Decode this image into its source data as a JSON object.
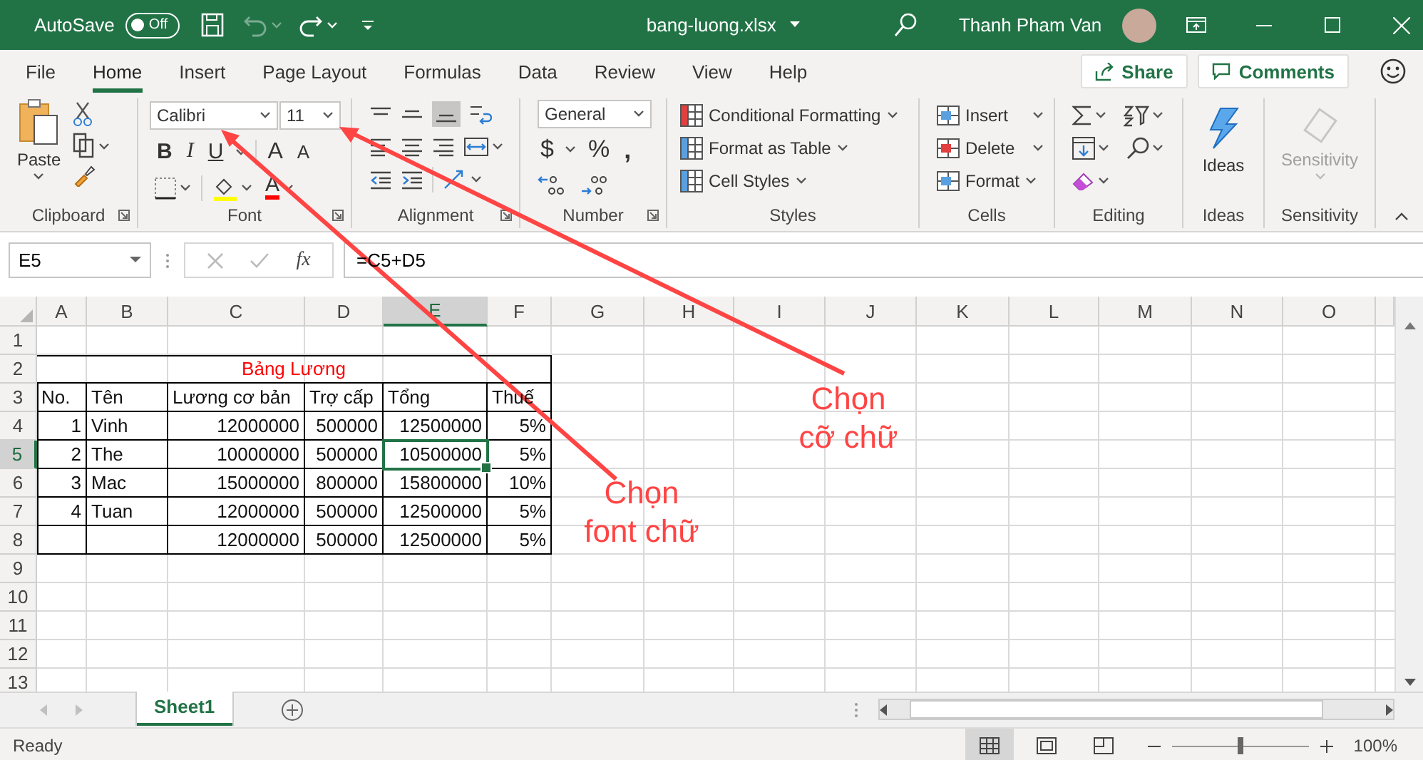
{
  "title_bar": {
    "autosave_label": "AutoSave",
    "autosave_toggle": {
      "label": "Off",
      "on": false
    },
    "undo": {
      "disabled": true
    },
    "filename": "bang-luong.xlsx",
    "user_name": "Thanh Pham Van"
  },
  "menu_tabs": [
    {
      "label": "File",
      "selected": false
    },
    {
      "label": "Home",
      "selected": true
    },
    {
      "label": "Insert",
      "selected": false
    },
    {
      "label": "Page Layout",
      "selected": false
    },
    {
      "label": "Formulas",
      "selected": false
    },
    {
      "label": "Data",
      "selected": false
    },
    {
      "label": "Review",
      "selected": false
    },
    {
      "label": "View",
      "selected": false
    },
    {
      "label": "Help",
      "selected": false
    }
  ],
  "share_button": "Share",
  "comments_button": "Comments",
  "ribbon": {
    "clipboard": {
      "label": "Clipboard",
      "paste": "Paste"
    },
    "font": {
      "label": "Font",
      "font_name": "Calibri",
      "font_size": "11",
      "style_buttons": [
        "B",
        "I",
        "U"
      ],
      "size_buttons": [
        "A",
        "A"
      ],
      "font_color_button": "A"
    },
    "alignment": {
      "label": "Alignment"
    },
    "number": {
      "label": "Number",
      "format": "General",
      "symbols": [
        "$",
        "%",
        ","
      ]
    },
    "styles": {
      "label": "Styles",
      "items": [
        "Conditional Formatting",
        "Format as Table",
        "Cell Styles"
      ]
    },
    "cells": {
      "label": "Cells",
      "items": [
        "Insert",
        "Delete",
        "Format"
      ]
    },
    "editing": {
      "label": "Editing"
    },
    "ideas": {
      "label": "Ideas",
      "button": "Ideas"
    },
    "sensitivity": {
      "label": "Sensitivity",
      "button": "Sensitivity",
      "disabled": true
    }
  },
  "formula_bar": {
    "name_box": "E5",
    "fx": "fx",
    "formula": "=C5+D5"
  },
  "sheet": {
    "columns": [
      {
        "label": "A",
        "selected": false
      },
      {
        "label": "B",
        "selected": false
      },
      {
        "label": "C",
        "selected": false
      },
      {
        "label": "D",
        "selected": false
      },
      {
        "label": "E",
        "selected": true
      },
      {
        "label": "F",
        "selected": false
      },
      {
        "label": "G",
        "selected": false
      },
      {
        "label": "H",
        "selected": false
      },
      {
        "label": "I",
        "selected": false
      },
      {
        "label": "J",
        "selected": false
      },
      {
        "label": "K",
        "selected": false
      },
      {
        "label": "L",
        "selected": false
      },
      {
        "label": "M",
        "selected": false
      },
      {
        "label": "N",
        "selected": false
      },
      {
        "label": "O",
        "selected": false
      }
    ],
    "rows": [
      {
        "number": "1",
        "selected": false
      },
      {
        "number": "2",
        "selected": false,
        "title": "Bảng Lương"
      },
      {
        "number": "3",
        "selected": false,
        "kind": "header",
        "cells": {
          "A": "No.",
          "B": "Tên",
          "C": "Lương cơ bản",
          "D": "Trợ cấp",
          "E": "Tổng",
          "F": "Thuế"
        }
      },
      {
        "number": "4",
        "selected": false,
        "kind": "data",
        "cells": {
          "A": "1",
          "B": "Vinh",
          "C": "12000000",
          "D": "500000",
          "E": "12500000",
          "F": "5%"
        }
      },
      {
        "number": "5",
        "selected": true,
        "kind": "data",
        "cells": {
          "A": "2",
          "B": "The",
          "C": "10000000",
          "D": "500000",
          "E": "10500000",
          "F": "5%"
        }
      },
      {
        "number": "6",
        "selected": false,
        "kind": "data",
        "cells": {
          "A": "3",
          "B": "Mac",
          "C": "15000000",
          "D": "800000",
          "E": "15800000",
          "F": "10%"
        }
      },
      {
        "number": "7",
        "selected": false,
        "kind": "data",
        "cells": {
          "A": "4",
          "B": "Tuan",
          "C": "12000000",
          "D": "500000",
          "E": "12500000",
          "F": "5%"
        }
      },
      {
        "number": "8",
        "selected": false,
        "kind": "data",
        "cells": {
          "C": "12000000",
          "D": "500000",
          "E": "12500000",
          "F": "5%"
        }
      },
      {
        "number": "9",
        "selected": false
      },
      {
        "number": "10",
        "selected": false
      },
      {
        "number": "11",
        "selected": false
      },
      {
        "number": "12",
        "selected": false
      },
      {
        "number": "13",
        "selected": false
      }
    ]
  },
  "sheet_tabs": [
    {
      "label": "Sheet1",
      "selected": true
    }
  ],
  "status_bar": {
    "status": "Ready",
    "views": [
      {
        "selected": true
      },
      {
        "selected": false
      },
      {
        "selected": false
      }
    ],
    "zoom": {
      "level": 0.5
    },
    "zoom_reading": "100%"
  },
  "annotations": [
    {
      "lines": [
        "Chọn",
        "cỡ chữ"
      ]
    },
    {
      "lines": [
        "Chọn",
        "font chữ"
      ]
    }
  ]
}
